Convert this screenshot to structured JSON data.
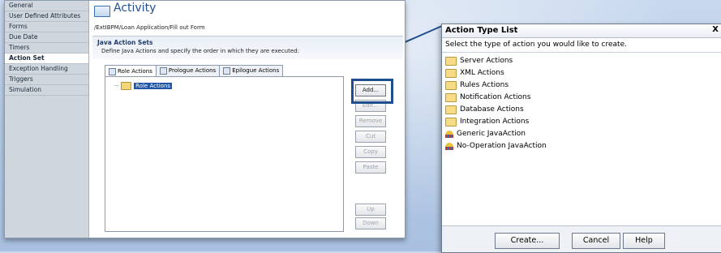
{
  "left_panel": {
    "nav_items": [
      "General",
      "User Defined Attributes",
      "Forms",
      "Due Date",
      "Timers",
      "Action Set",
      "Exception Handling",
      "Triggers",
      "Simulation"
    ],
    "selected_nav": "Action Set",
    "title": "Activity",
    "breadcrumb": "/ExtIBPM/Loan Application/Fill out Form",
    "section_title": "Java Action Sets",
    "section_desc": "Define Java Actions and specify the order in which they are executed:",
    "tabs": [
      "Role Actions",
      "Prologue Actions",
      "Epilogue Actions"
    ],
    "tree_item": "Role Actions",
    "buttons": {
      "add": "Add...",
      "edit": "Edit...",
      "remove": "Remove",
      "cut": "Cut",
      "copy": "Copy",
      "paste": "Paste",
      "up": "Up",
      "down": "Down"
    }
  },
  "dialog": {
    "title": "Action Type List",
    "close": "X",
    "instruction": "Select the type of action you would like to create.",
    "items": [
      {
        "label": "Server Actions",
        "icon": "folder-icon"
      },
      {
        "label": "XML Actions",
        "icon": "folder-icon"
      },
      {
        "label": "Rules Actions",
        "icon": "folder-icon"
      },
      {
        "label": "Notification Actions",
        "icon": "folder-icon"
      },
      {
        "label": "Database Actions",
        "icon": "folder-icon"
      },
      {
        "label": "Integration Actions",
        "icon": "folder-icon"
      },
      {
        "label": "Generic JavaAction",
        "icon": "java-action-icon"
      },
      {
        "label": "No-Operation JavaAction",
        "icon": "java-action-icon"
      }
    ],
    "buttons": {
      "create": "Create...",
      "cancel": "Cancel",
      "help": "Help"
    }
  },
  "colors": {
    "accent": "#1d4f8f",
    "title_blue": "#1f4e96",
    "background": "#b6cbe6"
  }
}
